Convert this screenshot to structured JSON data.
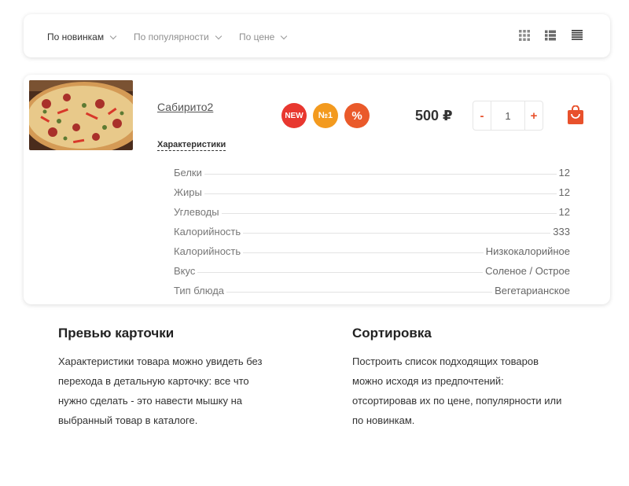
{
  "sort": {
    "items": [
      {
        "label": "По новинкам"
      },
      {
        "label": "По популярности"
      },
      {
        "label": "По цене"
      }
    ],
    "views": [
      "tile-view-icon",
      "list-view-icon",
      "table-view-icon"
    ]
  },
  "product": {
    "name": "Сабирито2",
    "badges": [
      {
        "label": "NEW",
        "color": "#e8372f"
      },
      {
        "label": "№1",
        "color": "#f39a1e"
      },
      {
        "label": "%",
        "color": "#ea5a2a"
      }
    ],
    "price": "500 ₽",
    "quantity": "1",
    "minus": "-",
    "plus": "+",
    "characteristics_label": "Характеристики",
    "characteristics": [
      {
        "name": "Белки",
        "value": "12"
      },
      {
        "name": "Жиры",
        "value": "12"
      },
      {
        "name": "Углеводы",
        "value": "12"
      },
      {
        "name": "Калорийность",
        "value": "333"
      },
      {
        "name": "Калорийность",
        "value": "Низкокалорийное"
      },
      {
        "name": "Вкус",
        "value": "Соленое / Острое"
      },
      {
        "name": "Тип блюда",
        "value": "Вегетарианское"
      }
    ]
  },
  "info": [
    {
      "title": "Превью карточки",
      "text": "Характеристики товара можно увидеть без\nперехода в  детальную карточку: все что\nнужно сделать - это навести мышку на\nвыбранный товар в каталоге."
    },
    {
      "title": "Сортировка",
      "text": "Построить список подходящих товаров\nможно исходя из предпочтений:\nотсортировав их по цене, популярности или\nпо новинкам."
    }
  ],
  "colors": {
    "accent": "#e8512c"
  }
}
